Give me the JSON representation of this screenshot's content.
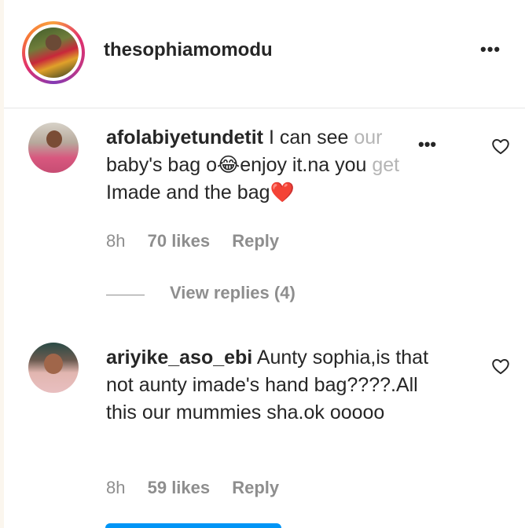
{
  "header": {
    "username": "thesophiamomodu",
    "more_label": "•••"
  },
  "comments": [
    {
      "username": "afolabiyetundetit",
      "text_start": "I can see ",
      "text_faded_1": "our",
      "text_middle": "baby's bag o😂enjoy it.na you ",
      "text_faded_2": "get",
      "text_end": "Imade and the bag❤️",
      "more_label": "•••",
      "time": "8h",
      "likes": "70 likes",
      "reply_label": "Reply"
    },
    {
      "username": "ariyike_aso_ebi",
      "text": "Aunty sophia,is that not aunty imade's hand bag????.All this our mummies sha.ok ooooo",
      "time": "8h",
      "likes": "59 likes",
      "reply_label": "Reply"
    }
  ],
  "view_replies": {
    "label": "View replies (4)"
  },
  "colors": {
    "accent": "#0095f6",
    "muted": "#8e8e8e",
    "text": "#262626"
  },
  "icons": [
    "more-icon",
    "heart-icon"
  ]
}
